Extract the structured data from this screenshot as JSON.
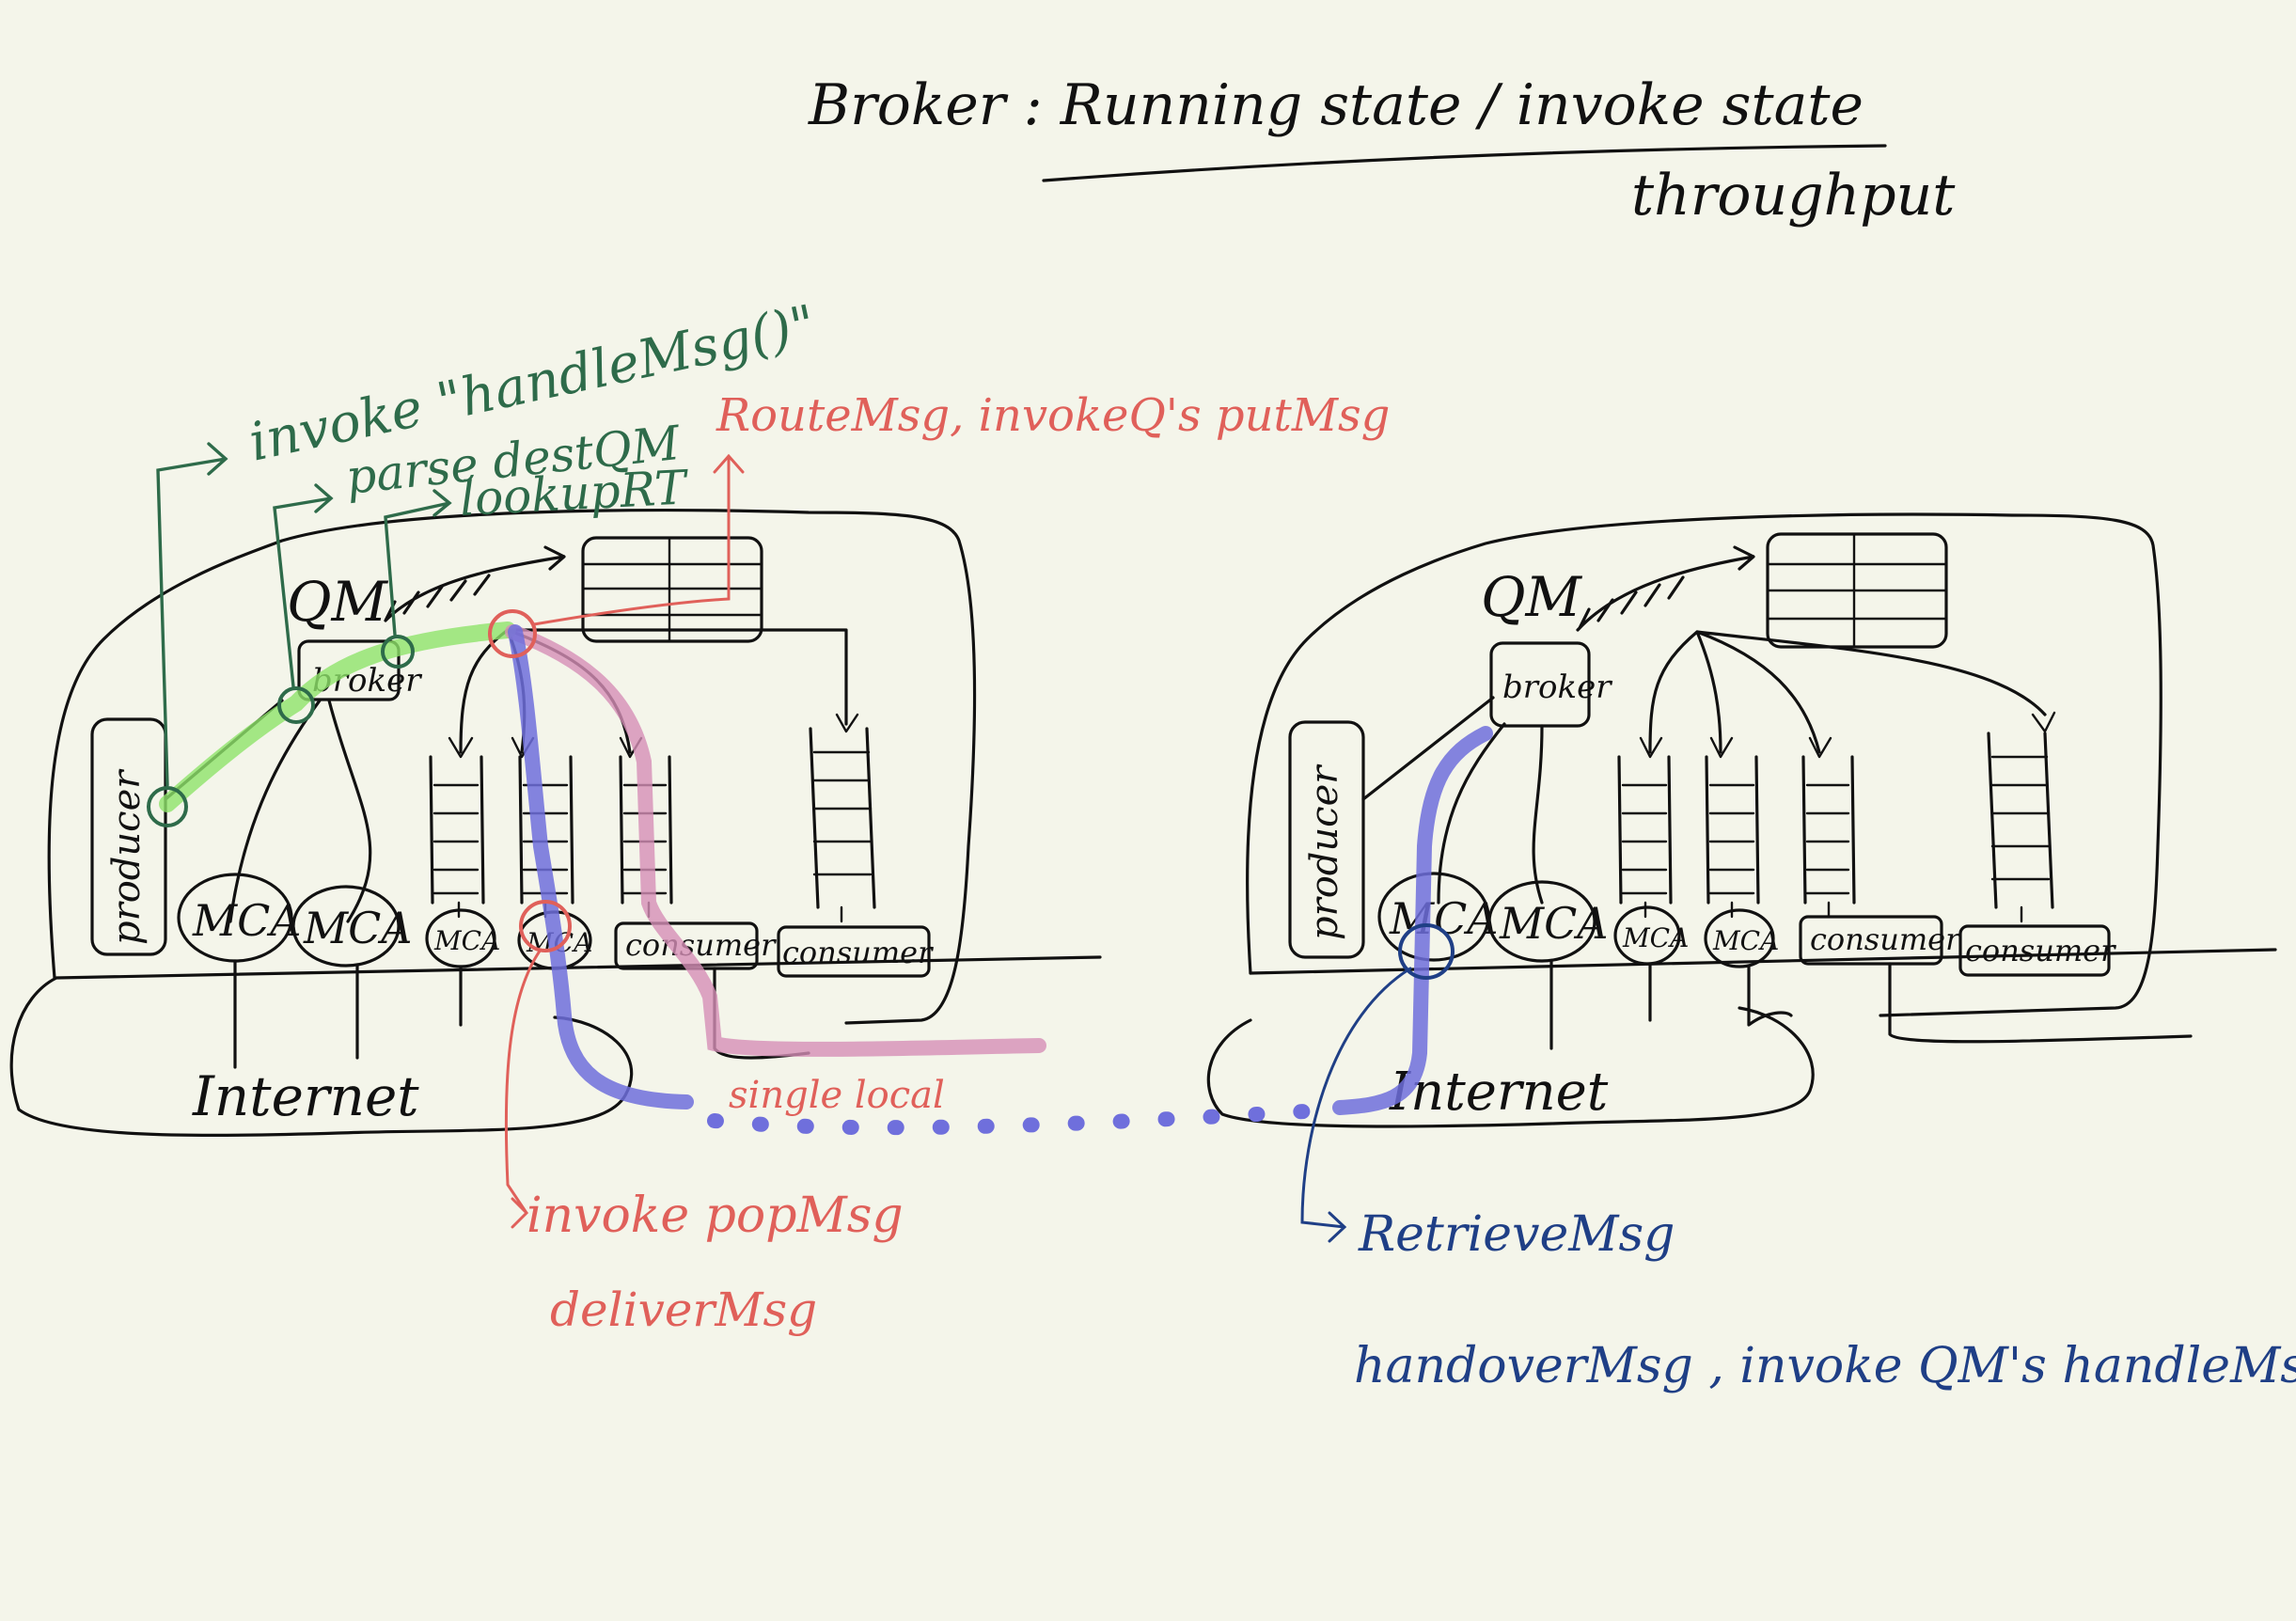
{
  "header": {
    "title": "Broker : Running state / invoke state",
    "subtitle": "throughput"
  },
  "left_qm": {
    "qm_label": "QM",
    "broker_label": "broker",
    "producer_label": "producer",
    "mca_labels": [
      "MCA",
      "MCA",
      "MCA",
      "MCA"
    ],
    "consumer_labels": [
      "consumer",
      "consumer"
    ],
    "internet_label": "Internet"
  },
  "right_qm": {
    "qm_label": "QM",
    "broker_label": "broker",
    "producer_label": "producer",
    "mca_labels": [
      "MCA",
      "MCA",
      "MCA",
      "MCA"
    ],
    "consumer_labels": [
      "consumer",
      "consumer"
    ],
    "internet_label": "Internet"
  },
  "annotations": {
    "green": {
      "color": "#2e6b4a",
      "lines": [
        "invoke \"handleMsg()\"",
        "parse destQM",
        "lookupRT"
      ]
    },
    "red": {
      "color": "#e0605a",
      "route": "RouteMsg, invokeQ's putMsg",
      "single_local": "single local",
      "pop": "invoke popMsg",
      "deliver": "deliverMsg"
    },
    "blue": {
      "color": "#1f3f86",
      "retrieve": "RetrieveMsg",
      "handover": "handoverMsg , invoke QM's handleMsg"
    }
  },
  "colors": {
    "ink": "#111111",
    "highlight_green": "#8ee46a",
    "highlight_blue": "#6f6fdc",
    "highlight_pink": "#d68fb6",
    "paper": "#f4f5ea"
  }
}
